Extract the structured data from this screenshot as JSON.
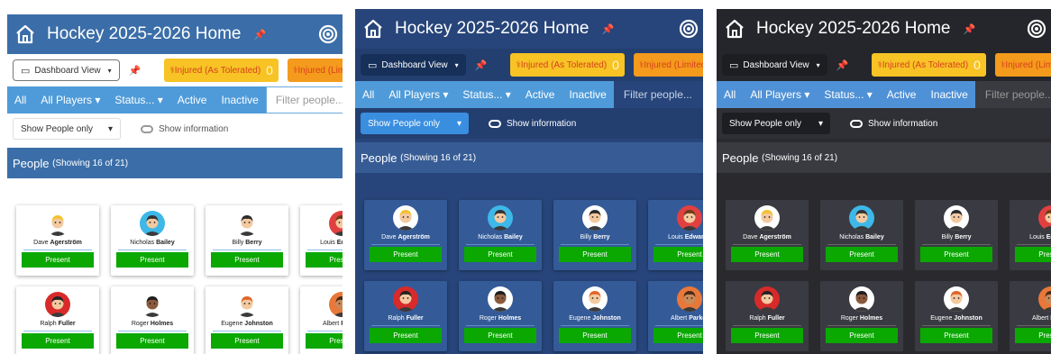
{
  "app": {
    "title": "Hockey 2025-2026 Home",
    "pin_glyph": "📌"
  },
  "toolbar": {
    "dashboard_label": "Dashboard View",
    "badges": [
      {
        "label": "Injured (As Tolerated)",
        "count": "0"
      },
      {
        "label": "Injured (Limited)"
      }
    ]
  },
  "filters": {
    "all": "All",
    "players": "All Players",
    "status": "Status...",
    "active": "Active",
    "inactive": "Inactive",
    "placeholder": "Filter people..."
  },
  "options": {
    "show_selected": "Show People only",
    "show_information": "Show information"
  },
  "people": {
    "heading": "People",
    "count_text": "(Showing 16 of 21)"
  },
  "cards": [
    {
      "first": "Dave",
      "last": "Agerström",
      "status": "Present",
      "avatar": "hard-hat-avatar",
      "bg": "#ffffff",
      "skin": "#f3c9a0",
      "hair": "#f2c230"
    },
    {
      "first": "Nicholas",
      "last": "Bailey",
      "status": "Present",
      "avatar": "blue-avatar",
      "bg": "#3db8e8",
      "skin": "#f3c9a0",
      "hair": "#333333"
    },
    {
      "first": "Billy",
      "last": "Berry",
      "status": "Present",
      "avatar": "beard-avatar",
      "bg": "#ffffff",
      "skin": "#f3c9a0",
      "hair": "#2b2b2b"
    },
    {
      "first": "Louis",
      "last": "Edwards",
      "status": "Present",
      "avatar": "red-avatar",
      "bg": "#e04040",
      "skin": "#f3c9a0",
      "hair": "#6a3c1a"
    },
    {
      "first": "Ralph",
      "last": "Fuller",
      "status": "Present",
      "avatar": "red-avatar",
      "bg": "#d82a2a",
      "skin": "#f3c9a0",
      "hair": "#222222"
    },
    {
      "first": "Roger",
      "last": "Holmes",
      "status": "Present",
      "avatar": "curly-avatar",
      "bg": "#ffffff",
      "skin": "#8a5a3c",
      "hair": "#1e1e1e"
    },
    {
      "first": "Eugene",
      "last": "Johnston",
      "status": "Present",
      "avatar": "ginger-avatar",
      "bg": "#ffffff",
      "skin": "#f3c9a0",
      "hair": "#e0662a"
    },
    {
      "first": "Albert",
      "last": "Parker",
      "status": "Present",
      "avatar": "orange-avatar",
      "bg": "#e8783a",
      "skin": "#c98a5a",
      "hair": "#4a2a16"
    }
  ]
}
